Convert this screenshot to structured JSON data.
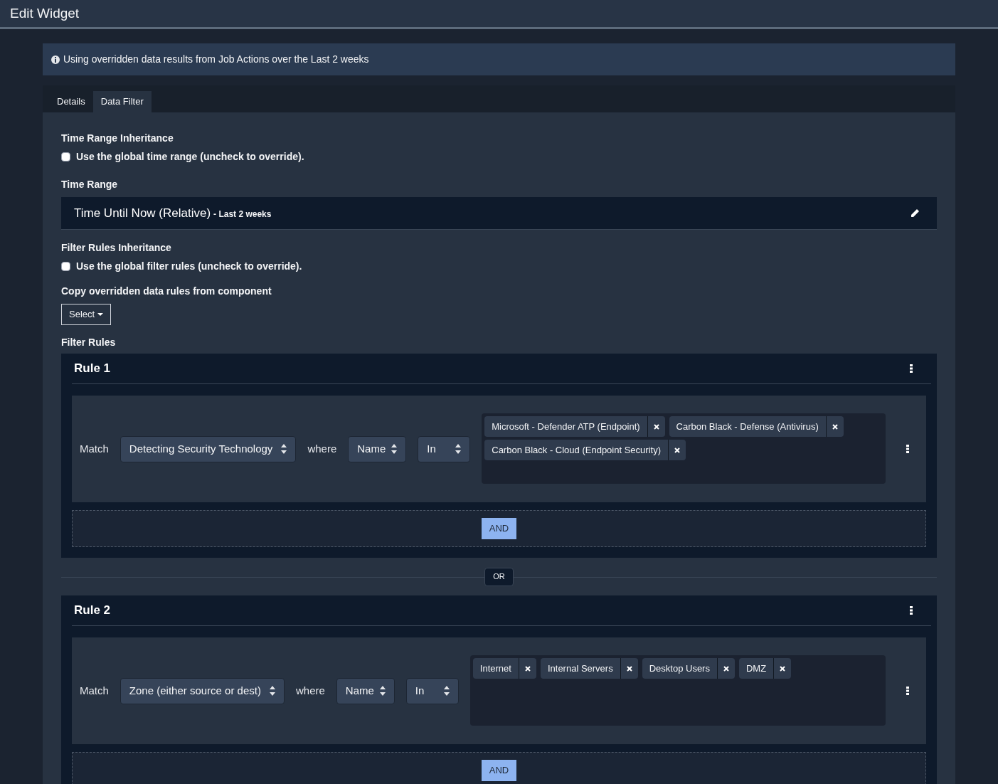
{
  "header": {
    "title": "Edit Widget"
  },
  "info": {
    "text": "Using overridden data results from Job Actions over the Last 2 weeks"
  },
  "tabs": [
    {
      "label": "Details",
      "selected": false
    },
    {
      "label": "Data Filter",
      "selected": true
    }
  ],
  "time_range_inheritance": {
    "heading": "Time Range Inheritance",
    "checkbox": {
      "label": "Use the global time range (uncheck to override).",
      "checked": false
    }
  },
  "time_range": {
    "heading": "Time Range",
    "title": "Time Until Now (Relative)",
    "detail": "- Last 2 weeks"
  },
  "filter_rules_inheritance": {
    "heading": "Filter Rules Inheritance",
    "checkbox": {
      "label": "Use the global filter rules (uncheck to override).",
      "checked": false
    }
  },
  "copy_rules": {
    "heading": "Copy overridden data rules from component",
    "button": "Select"
  },
  "filter_rules": {
    "heading": "Filter Rules",
    "joiner": "OR",
    "rules": [
      {
        "title": "Rule 1",
        "match_label": "Match",
        "field": "Detecting Security Technology",
        "where_label": "where",
        "attribute": "Name",
        "operator": "In",
        "values": [
          "Microsoft - Defender ATP (Endpoint)",
          "Carbon Black - Defense (Antivirus)",
          "Carbon Black - Cloud (Endpoint Security)"
        ],
        "add_button": "AND"
      },
      {
        "title": "Rule 2",
        "match_label": "Match",
        "field": "Zone (either source or dest)",
        "where_label": "where",
        "attribute": "Name",
        "operator": "In",
        "values": [
          "Internet",
          "Internal Servers",
          "Desktop Users",
          "DMZ"
        ],
        "add_button": "AND"
      }
    ]
  }
}
